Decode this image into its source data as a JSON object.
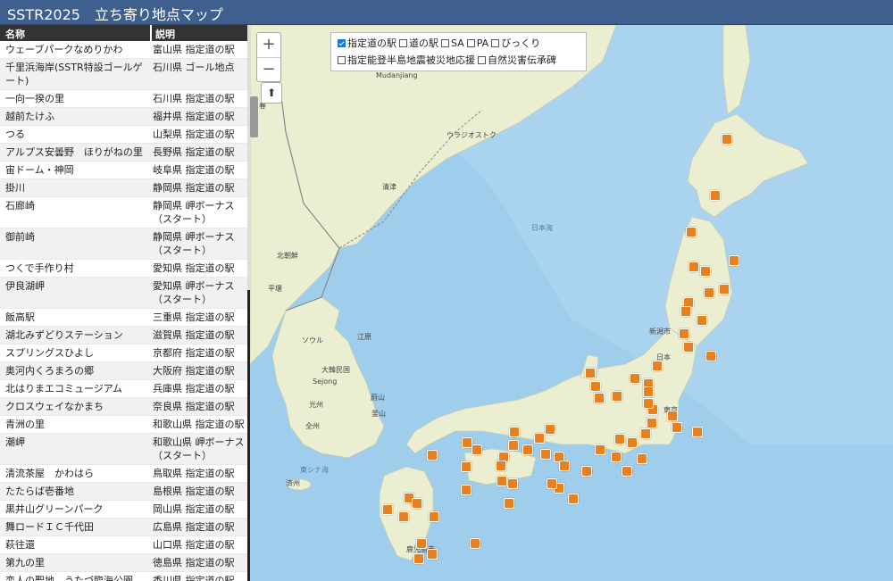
{
  "header": {
    "title": "SSTR2025　立ち寄り地点マップ"
  },
  "table": {
    "col_name": "名称",
    "col_desc": "説明",
    "rows": [
      {
        "name": "ウェーブパークなめりかわ",
        "desc": "富山県 指定道の駅"
      },
      {
        "name": "千里浜海岸(SSTR特設ゴールゲート)",
        "desc": "石川県 ゴール地点"
      },
      {
        "name": "一向一揆の里",
        "desc": "石川県 指定道の駅"
      },
      {
        "name": "越前たけふ",
        "desc": "福井県 指定道の駅"
      },
      {
        "name": "つる",
        "desc": "山梨県 指定道の駅"
      },
      {
        "name": "アルプス安曇野　ほりがねの里",
        "desc": "長野県 指定道の駅"
      },
      {
        "name": "宙ドーム・神岡",
        "desc": "岐阜県 指定道の駅"
      },
      {
        "name": "掛川",
        "desc": "静岡県 指定道の駅"
      },
      {
        "name": "石廊崎",
        "desc": "静岡県 岬ボーナス（スタート）"
      },
      {
        "name": "御前崎",
        "desc": "静岡県 岬ボーナス（スタート）"
      },
      {
        "name": "つくで手作り村",
        "desc": "愛知県 指定道の駅"
      },
      {
        "name": "伊良湖岬",
        "desc": "愛知県 岬ボーナス（スタート）"
      },
      {
        "name": "飯高駅",
        "desc": "三重県 指定道の駅"
      },
      {
        "name": "湖北みずどりステーション",
        "desc": "滋賀県 指定道の駅"
      },
      {
        "name": "スプリングスひよし",
        "desc": "京都府 指定道の駅"
      },
      {
        "name": "奥河内くろまろの郷",
        "desc": "大阪府 指定道の駅"
      },
      {
        "name": "北はりまエコミュージアム",
        "desc": "兵庫県 指定道の駅"
      },
      {
        "name": "クロスウェイなかまち",
        "desc": "奈良県 指定道の駅"
      },
      {
        "name": "青洲の里",
        "desc": "和歌山県 指定道の駅"
      },
      {
        "name": "潮岬",
        "desc": "和歌山県 岬ボーナス（スタート）"
      },
      {
        "name": "清流茶屋　かわはら",
        "desc": "鳥取県 指定道の駅"
      },
      {
        "name": "たたらば壱番地",
        "desc": "島根県 指定道の駅"
      },
      {
        "name": "黒井山グリーンパーク",
        "desc": "岡山県 指定道の駅"
      },
      {
        "name": "舞ロードＩＣ千代田",
        "desc": "広島県 指定道の駅"
      },
      {
        "name": "萩往還",
        "desc": "山口県 指定道の駅"
      },
      {
        "name": "第九の里",
        "desc": "徳島県 指定道の駅"
      },
      {
        "name": "恋人の聖地　うたづ臨海公園",
        "desc": "香川県 指定道の駅"
      }
    ]
  },
  "map_controls": {
    "zoom_in": "+",
    "zoom_out": "−",
    "compass": "⬆"
  },
  "filters": [
    {
      "label": "指定道の駅",
      "checked": true
    },
    {
      "label": "道の駅",
      "checked": false
    },
    {
      "label": "SA",
      "checked": false
    },
    {
      "label": "PA",
      "checked": false
    },
    {
      "label": "びっくり",
      "checked": false
    },
    {
      "label": "指定能登半島地震被災地応援",
      "checked": false
    },
    {
      "label": "自然災害伝承碑",
      "checked": false
    }
  ],
  "map_labels": {
    "mudanjiang": "Mudanjiang",
    "vladivostok": "ウラジオストク",
    "seishin": "清津",
    "north_korea": "北朝鮮",
    "pyongyang": "平壌",
    "seoul": "ソウル",
    "korea": "大韓民国",
    "sejong": "Sejong",
    "japan_sea": "日本海",
    "japan": "日本",
    "niigata": "新潟市",
    "tokyo": "東京",
    "kagoshima": "鹿児島市",
    "jeju": "済州",
    "east_china_sea": "東シナ海",
    "gangwon": "江原",
    "gwangju": "光州",
    "ulsan": "蔚山",
    "busan": "釜山",
    "daejeon": "全州",
    "chunchun": "春"
  },
  "marker_colors": {
    "orange": "#e8801f"
  },
  "colors": {
    "header_bg": "#3f5f8f",
    "land": "#eef1d2",
    "sea": "#a9d3ee"
  }
}
